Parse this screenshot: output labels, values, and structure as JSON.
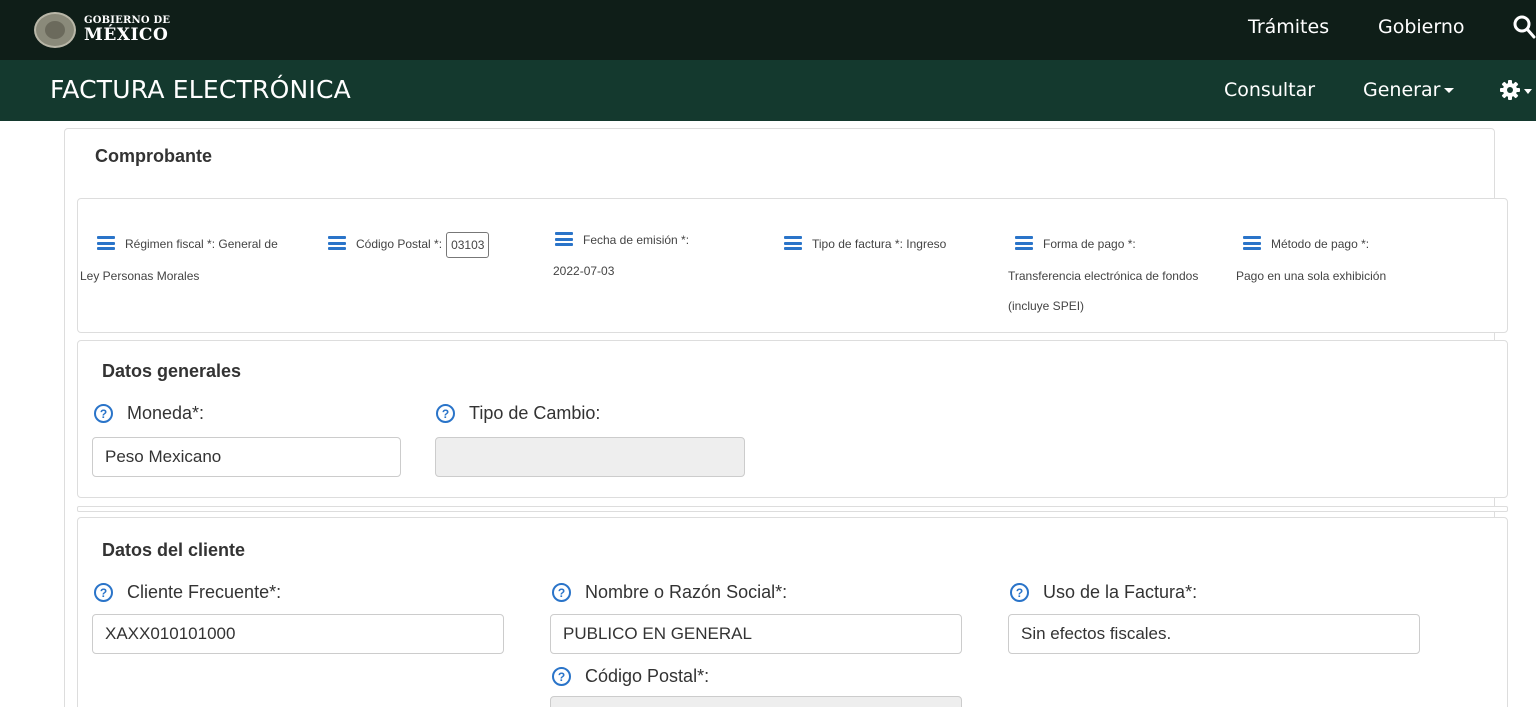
{
  "gov_bar": {
    "logo_line1": "GOBIERNO DE",
    "logo_line2": "MÉXICO",
    "nav": [
      "Trámites",
      "Gobierno"
    ],
    "search_icon": "search-icon"
  },
  "app_bar": {
    "title": "FACTURA ELECTRÓNICA",
    "consultar": "Consultar",
    "generar": "Generar",
    "settings_icon": "gear-icon"
  },
  "comprobante": {
    "title": "Comprobante",
    "items": [
      {
        "label": "Régimen fiscal *:",
        "value_a": "General de",
        "value_b": "Ley Personas Morales"
      },
      {
        "label": "Código Postal *:",
        "value": "03103"
      },
      {
        "label": "Fecha de emisión *:",
        "value": "2022-07-03"
      },
      {
        "label": "Tipo de factura *:",
        "value": "Ingreso"
      },
      {
        "label": "Forma de pago *:",
        "value_a": "Transferencia electrónica de fondos",
        "value_b": "(incluye SPEI)"
      },
      {
        "label": "Método de pago *:",
        "value": "Pago en una sola exhibición"
      }
    ]
  },
  "datos_generales": {
    "title": "Datos generales",
    "moneda_label": "Moneda*:",
    "moneda_value": "Peso Mexicano",
    "tipo_cambio_label": "Tipo de Cambio:",
    "tipo_cambio_value": ""
  },
  "datos_cliente": {
    "title": "Datos del cliente",
    "cliente_label": "Cliente Frecuente*:",
    "cliente_value": "XAXX010101000",
    "nombre_label": "Nombre o Razón Social*:",
    "nombre_value": "PUBLICO EN GENERAL",
    "uso_label": "Uso de la Factura*:",
    "uso_value": "Sin efectos fiscales.",
    "cp_label": "Código Postal*:",
    "cp_value": ""
  },
  "help_glyph": "?"
}
